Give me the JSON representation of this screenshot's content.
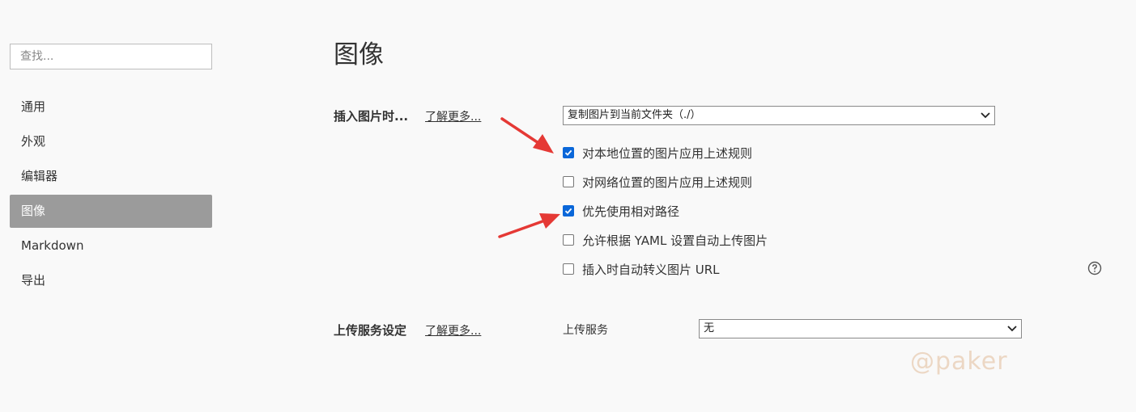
{
  "sidebar": {
    "search": {
      "placeholder": "查找..."
    },
    "items": [
      {
        "label": "通用"
      },
      {
        "label": "外观"
      },
      {
        "label": "编辑器"
      },
      {
        "label": "图像",
        "active": true
      },
      {
        "label": "Markdown"
      },
      {
        "label": "导出"
      }
    ]
  },
  "main": {
    "title": "图像",
    "insert_section": {
      "label": "插入图片时...",
      "learn_more": "了解更多...",
      "select_value": "复制图片到当前文件夹（./）",
      "options": [
        {
          "label": "对本地位置的图片应用上述规则",
          "checked": true
        },
        {
          "label": "对网络位置的图片应用上述规则",
          "checked": false
        },
        {
          "label": "优先使用相对路径",
          "checked": true
        },
        {
          "label": "允许根据 YAML 设置自动上传图片",
          "checked": false
        },
        {
          "label": "插入时自动转义图片 URL",
          "checked": false
        }
      ]
    },
    "upload_section": {
      "label": "上传服务设定",
      "learn_more": "了解更多...",
      "service_label": "上传服务",
      "service_value": "无"
    }
  },
  "watermark": "@paker",
  "icons": {
    "help": "help-circle-icon",
    "dropdown": "chevron-down-icon",
    "check": "check-icon"
  },
  "colors": {
    "accent": "#0a67d9",
    "active_nav": "#9b9b9b",
    "annotation_arrow": "#e53935",
    "watermark": "#ecd7c4"
  }
}
